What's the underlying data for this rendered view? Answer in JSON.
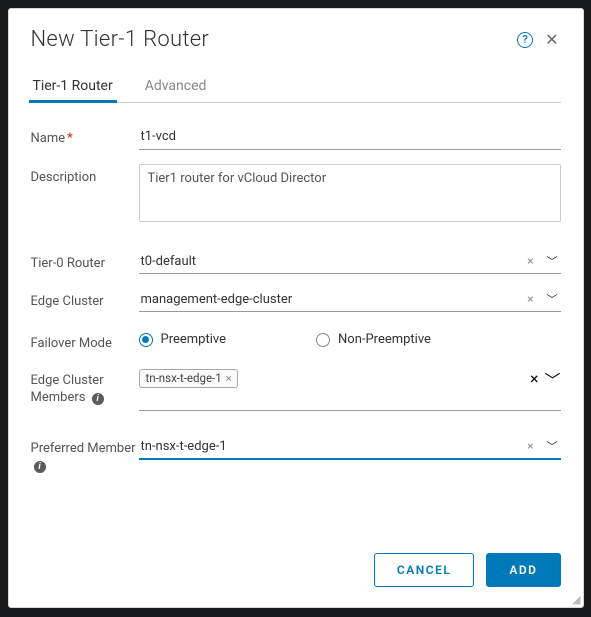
{
  "modal": {
    "title": "New Tier-1 Router"
  },
  "tabs": [
    {
      "label": "Tier-1 Router",
      "active": true
    },
    {
      "label": "Advanced",
      "active": false
    }
  ],
  "labels": {
    "name": "Name",
    "description": "Description",
    "tier0": "Tier-0 Router",
    "edgeCluster": "Edge Cluster",
    "failover": "Failover Mode",
    "edgeMembers": "Edge Cluster Members",
    "preferredMember": "Preferred Member"
  },
  "fields": {
    "name": "t1-vcd",
    "description": "Tier1 router for vCloud Director",
    "tier0": "t0-default",
    "edgeCluster": "management-edge-cluster",
    "failover": {
      "preemptive": "Preemptive",
      "nonPreemptive": "Non-Preemptive",
      "selected": "preemptive"
    },
    "edgeMembersChip": "tn-nsx-t-edge-1",
    "preferredMember": "tn-nsx-t-edge-1"
  },
  "buttons": {
    "cancel": "Cancel",
    "add": "Add"
  }
}
